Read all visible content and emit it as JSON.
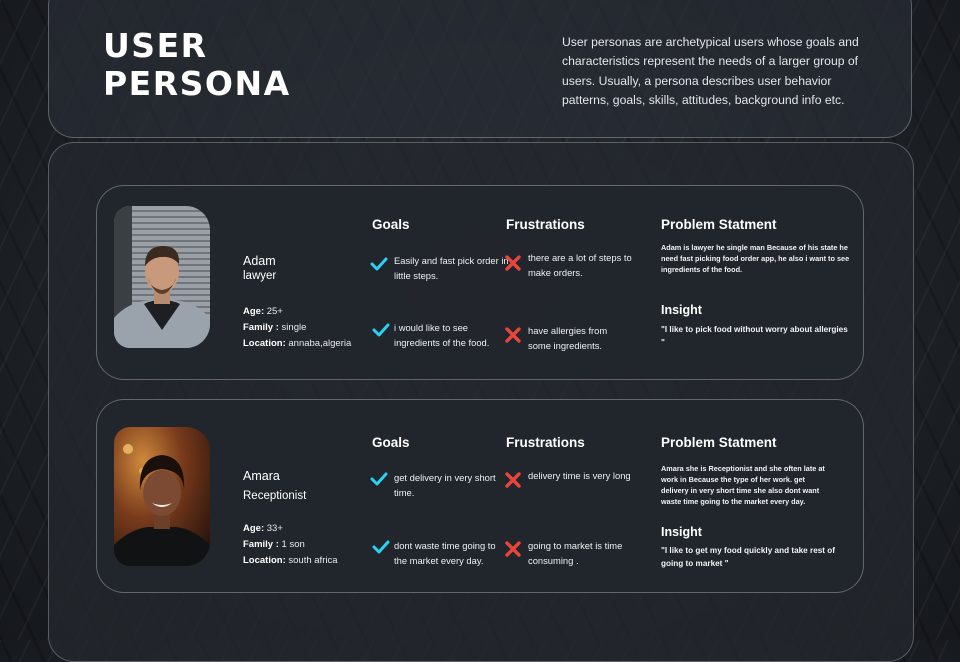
{
  "header": {
    "title_line1": "USER",
    "title_line2": "PERSONA",
    "intro": "User personas are archetypical users whose goals and characteristics represent the needs of a larger group of users. Usually, a persona describes user behavior patterns, goals, skills, attitudes, background info etc."
  },
  "labels": {
    "goals": "Goals",
    "frustrations": "Frustrations",
    "problem": "Problem Statment",
    "insight": "Insight",
    "age": "Age:",
    "family": "Family :",
    "location": "Location:"
  },
  "personas": [
    {
      "name": "Adam",
      "role": "lawyer",
      "age": "25+",
      "family": "single",
      "location": "annaba,algeria",
      "goals": [
        "Easily and fast pick order in little steps.",
        "i would like to see ingredients of the food."
      ],
      "frustrations": [
        "there are a lot of steps to make orders.",
        "have allergies from some ingredients."
      ],
      "problem": "Adam is lawyer he single man Because of his state he need fast picking food order app, he also i want to see ingredients of the food.",
      "insight": "\"I like to  pick food without worry about allergies \""
    },
    {
      "name": "Amara",
      "role": "Receptionist",
      "age": "33+",
      "family": "1 son",
      "location": "south africa",
      "goals": [
        "get delivery in very short time.",
        "dont  waste time going to the market every day."
      ],
      "frustrations": [
        "delivery time is very long",
        "going to market is time consuming ."
      ],
      "problem": "Amara  she is Receptionist and she often late at  work in Because the type of her work. get delivery in very short time she also dont  want waste time going to the market every day.",
      "insight": "\"I like to get my food quickly and take rest of going to market  \""
    }
  ],
  "colors": {
    "check": "#2bd1f0",
    "cross": "#e8453c"
  },
  "icons": {
    "goal": "check-icon",
    "frustration": "cross-icon"
  }
}
